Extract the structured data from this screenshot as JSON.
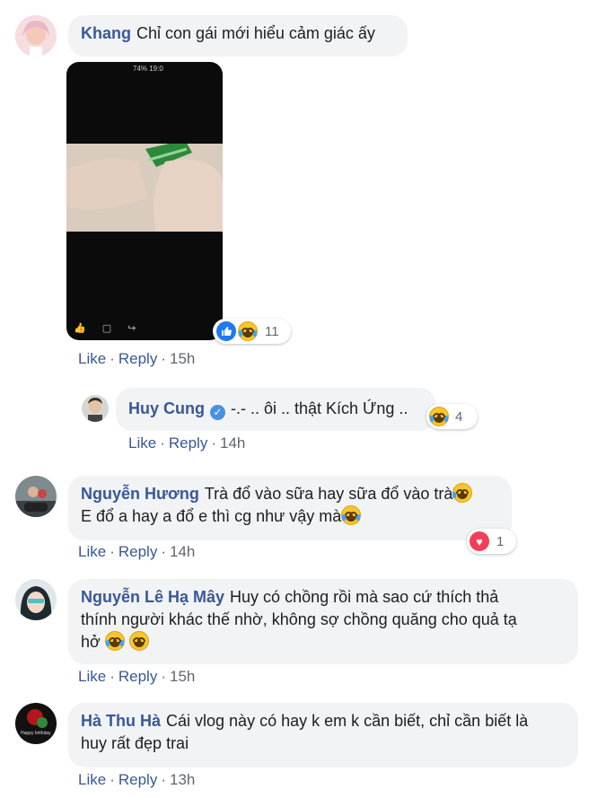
{
  "actions": {
    "like": "Like",
    "reply": "Reply",
    "sep": "·"
  },
  "comments": [
    {
      "name": "Khang",
      "text": "Chỉ con gái mới hiểu cảm giác ấy",
      "time": "15h",
      "reaction_count": "11",
      "reaction_icons": [
        "like-icon",
        "laugh-icon"
      ],
      "attachment": {
        "status_bar": "74%  19:0",
        "type": "phone-video-screenshot"
      }
    },
    {
      "name": "Huy Cung",
      "verified": true,
      "text": "-.- .. ôi .. thật Kích Ứng ..",
      "time": "14h",
      "reaction_count": "4",
      "reaction_icons": [
        "laugh-icon"
      ]
    },
    {
      "name": "Nguyễn Hương",
      "line1": "Trà đổ vào sữa hay sữa đổ vào trà",
      "line2": "E đổ a hay a đổ e thì cg như vậy mà",
      "time": "14h",
      "reaction_count": "1",
      "reaction_icons": [
        "love-icon"
      ]
    },
    {
      "name": "Nguyễn Lê Hạ Mây",
      "line1": "Huy có chồng rồi mà sao cứ thích thả",
      "line2": "thính người khác thế nhờ, không sợ chồng quăng cho quả tạ",
      "line3": "hở",
      "time": "15h"
    },
    {
      "name": "Hà Thu Hà",
      "line1": "Cái vlog này có hay k em k cần biết, chỉ cần biết là",
      "line2": "huy rất đẹp trai",
      "time": "13h",
      "avatar_text": "Happy birthday"
    }
  ],
  "colors": {
    "name": "#385898",
    "bubble": "#f2f3f5",
    "like_blue": "#2078f4",
    "love_red": "#f33e58",
    "meta": "#606770"
  }
}
